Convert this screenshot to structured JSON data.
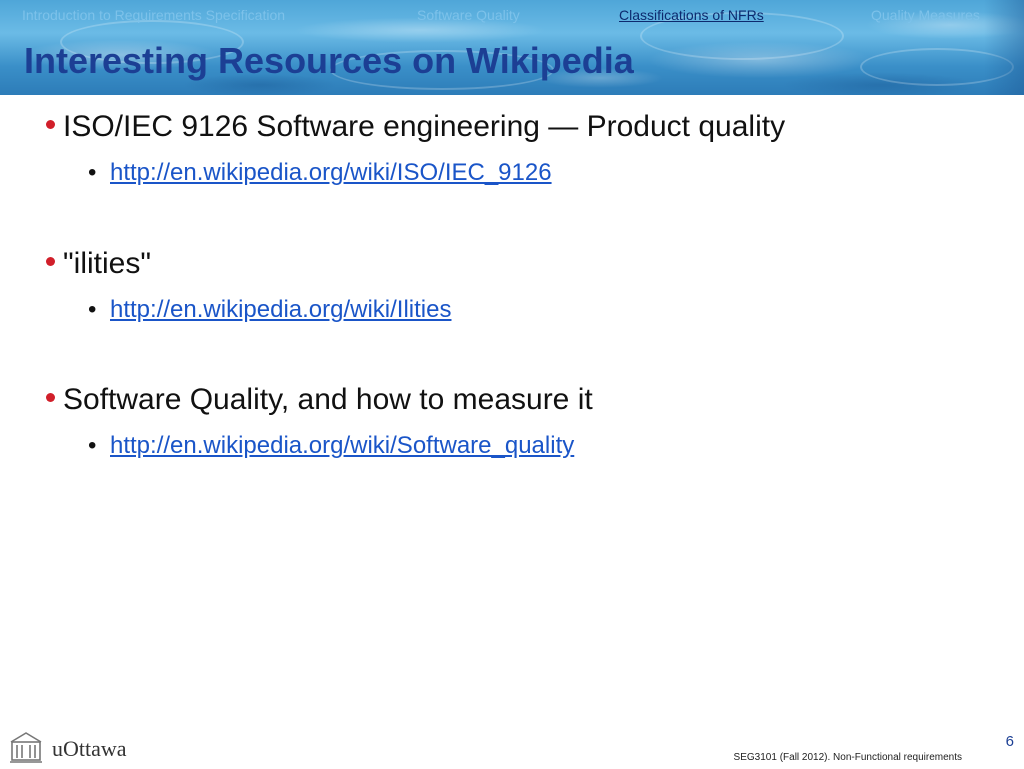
{
  "nav": {
    "items": [
      {
        "label": "Introduction to Requirements Specification",
        "active": false
      },
      {
        "label": "Software Quality",
        "active": false
      },
      {
        "label": "Classifications of NFRs",
        "active": true
      },
      {
        "label": "Quality Measures",
        "active": false
      }
    ]
  },
  "title": "Interesting Resources on Wikipedia",
  "bullets": [
    {
      "text": "ISO/IEC 9126 Software engineering — Product quality",
      "link": "http://en.wikipedia.org/wiki/ISO/IEC_9126"
    },
    {
      "text": "\"ilities\"",
      "link": "http://en.wikipedia.org/wiki/Ilities"
    },
    {
      "text": "Software Quality, and how to measure it",
      "link": "http://en.wikipedia.org/wiki/Software_quality"
    }
  ],
  "sub_bullet_glyph": "•",
  "footer": {
    "logo_text": "uOttawa",
    "page_number": "6",
    "course_text": "SEG3101 (Fall 2012).   Non-Functional requirements"
  },
  "colors": {
    "title": "#1c3f94",
    "bullet": "#d11f2a",
    "link": "#1a55c8",
    "nav_active": "#0d2a6e",
    "nav_inactive": "#7dc2ea"
  }
}
